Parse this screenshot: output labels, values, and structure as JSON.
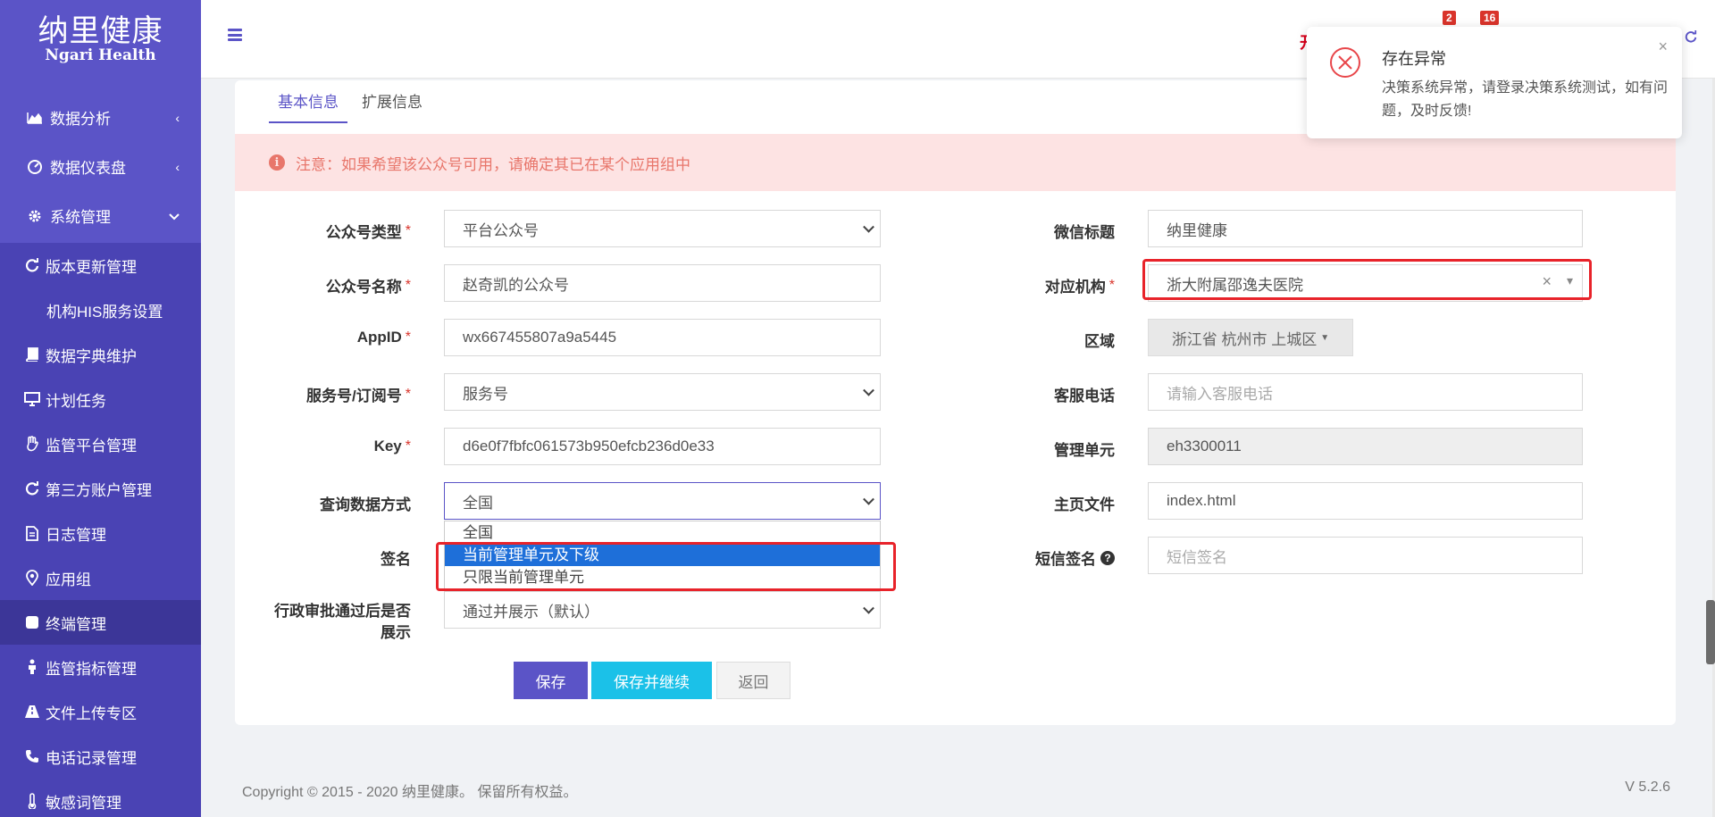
{
  "sidebar": {
    "logo_cn": "纳里健康",
    "logo_en": "Ngari Health",
    "items": [
      {
        "label": "数据分析",
        "icon": "area-chart-icon",
        "chevron": "‹"
      },
      {
        "label": "数据仪表盘",
        "icon": "dashboard-icon",
        "chevron": "‹"
      },
      {
        "label": "系统管理",
        "icon": "gear-icon",
        "chevron": "⌄"
      }
    ],
    "submenu": [
      {
        "label": "版本更新管理",
        "icon": "refresh-icon"
      },
      {
        "label": "机构HIS服务设置",
        "icon": ""
      },
      {
        "label": "数据字典维护",
        "icon": "book-icon"
      },
      {
        "label": "计划任务",
        "icon": "monitor-icon"
      },
      {
        "label": "监管平台管理",
        "icon": "hand-icon"
      },
      {
        "label": "第三方账户管理",
        "icon": "refresh-icon"
      },
      {
        "label": "日志管理",
        "icon": "file-icon"
      },
      {
        "label": "应用组",
        "icon": "location-icon"
      },
      {
        "label": "终端管理",
        "icon": "square-icon"
      },
      {
        "label": "监管指标管理",
        "icon": "person-icon"
      },
      {
        "label": "文件上传专区",
        "icon": "road-icon"
      },
      {
        "label": "电话记录管理",
        "icon": "phone-icon"
      },
      {
        "label": "敏感词管理",
        "icon": "thermometer-icon"
      }
    ]
  },
  "header": {
    "partial_text": "开",
    "badge1": "2",
    "badge2": "16"
  },
  "tabs": [
    "基本信息",
    "扩展信息"
  ],
  "alert": "注意：如果希望该公众号可用，请确定其已在某个应用组中",
  "form_left": [
    {
      "label": "公众号类型",
      "required": "*",
      "value": "平台公众号",
      "type": "select"
    },
    {
      "label": "公众号名称",
      "required": "*",
      "value": "赵奇凯的公众号",
      "type": "input"
    },
    {
      "label": "AppID",
      "required": "*",
      "value": "wx667455807a9a5445",
      "type": "input"
    },
    {
      "label": "服务号/订阅号",
      "required": "*",
      "value": "服务号",
      "type": "select"
    },
    {
      "label": "Key",
      "required": "*",
      "value": "d6e0f7fbfc061573b950efcb236d0e33",
      "type": "input"
    },
    {
      "label": "查询数据方式",
      "required": "",
      "value": "全国",
      "type": "select"
    },
    {
      "label": "签名",
      "required": "",
      "value": "",
      "type": "input"
    },
    {
      "label": "行政审批通过后是否展示",
      "label_line1": "行政审批通过后是否",
      "label_line2": "展示",
      "required": "",
      "value": "通过并展示（默认）",
      "type": "select"
    }
  ],
  "query_dropdown_options": [
    "全国",
    "当前管理单元及下级",
    "只限当前管理单元"
  ],
  "query_dropdown_selected": "当前管理单元及下级",
  "form_right": [
    {
      "label": "微信标题",
      "value": "纳里健康",
      "placeholder": ""
    },
    {
      "label": "对应机构",
      "required": "*",
      "value": "浙大附属邵逸夫医院",
      "clear": "×",
      "arrow": "▾"
    },
    {
      "label": "区域",
      "value": "浙江省 杭州市 上城区"
    },
    {
      "label": "客服电话",
      "value": "",
      "placeholder": "请输入客服电话"
    },
    {
      "label": "管理单元",
      "value": "eh3300011"
    },
    {
      "label": "主页文件",
      "value": "index.html"
    },
    {
      "label": "短信签名",
      "value": "",
      "placeholder": "短信签名",
      "help": "?"
    }
  ],
  "buttons": {
    "save": "保存",
    "save_continue": "保存并继续",
    "back": "返回"
  },
  "footer": {
    "copyright": "Copyright © 2015 - 2020 纳里健康。 保留所有权益。",
    "version": "V 5.2.6"
  },
  "notification": {
    "title": "存在异常",
    "message": "决策系统异常，请登录决策系统测试，如有问题，及时反馈!",
    "close": "×"
  },
  "colors": {
    "sidebar": "#5b54c7",
    "accent": "#5b54c7",
    "info": "#1bc1e8",
    "highlight": "#e8232a",
    "error": "#e8464a"
  }
}
